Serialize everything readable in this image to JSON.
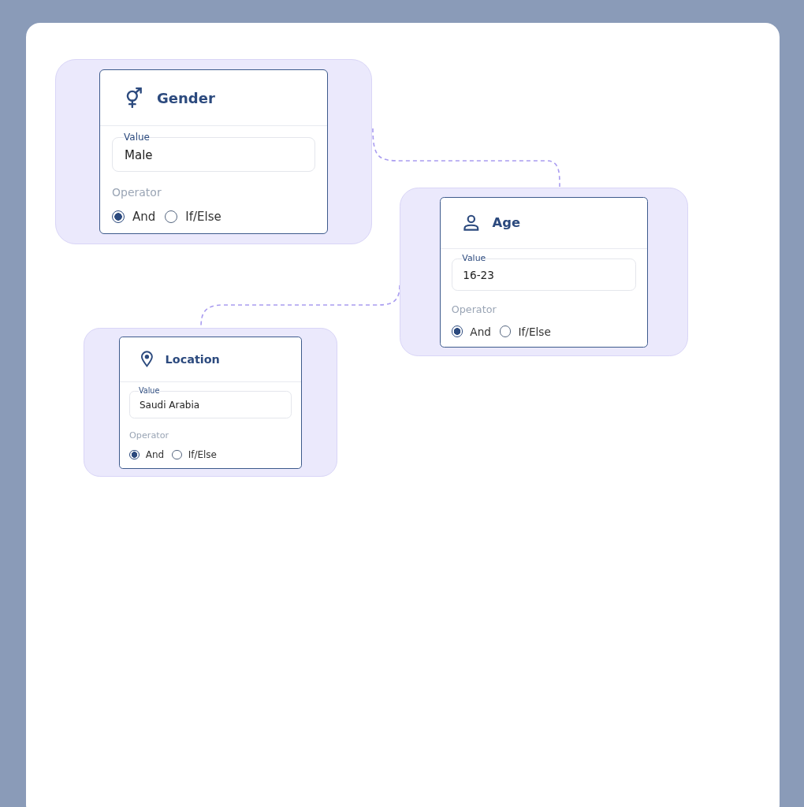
{
  "nodes": [
    {
      "kind": "gender",
      "title": "Gender",
      "value_label": "Value",
      "value": "Male",
      "operator_label": "Operator",
      "options": [
        {
          "label": "And",
          "selected": true
        },
        {
          "label": "If/Else",
          "selected": false
        }
      ]
    },
    {
      "kind": "person",
      "title": "Age",
      "value_label": "Value",
      "value": "16-23",
      "operator_label": "Operator",
      "options": [
        {
          "label": "And",
          "selected": true
        },
        {
          "label": "If/Else",
          "selected": false
        }
      ]
    },
    {
      "kind": "pin",
      "title": "Location",
      "value_label": "Value",
      "value": "Saudi Arabia",
      "operator_label": "Operator",
      "options": [
        {
          "label": "And",
          "selected": true
        },
        {
          "label": "If/Else",
          "selected": false
        }
      ]
    }
  ]
}
